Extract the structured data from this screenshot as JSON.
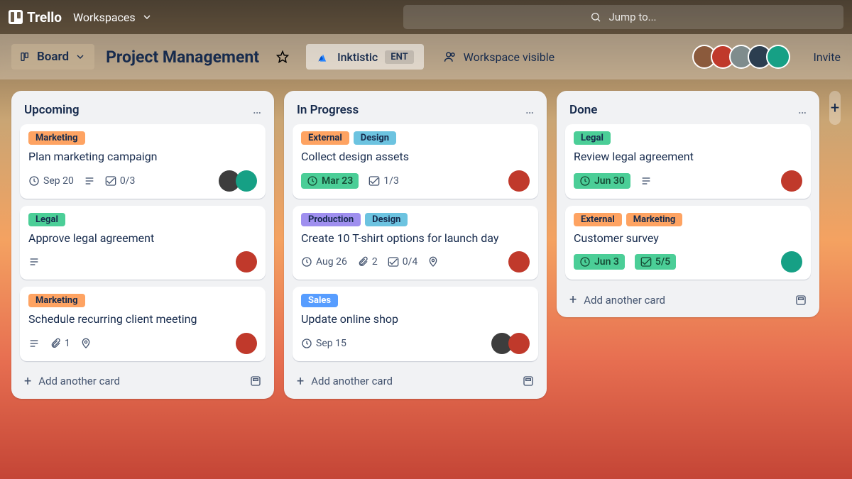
{
  "topbar": {
    "brand": "Trello",
    "workspaces_label": "Workspaces",
    "search_placeholder": "Jump to..."
  },
  "boardbar": {
    "view_label": "Board",
    "board_title": "Project Management",
    "workspace_name": "Inktistic",
    "workspace_badge": "ENT",
    "visibility_label": "Workspace visible",
    "invite_label": "Invite",
    "member_colors": [
      "#8b5a3c",
      "#c0392b",
      "#7f8c8d",
      "#2c3e50",
      "#16a085"
    ]
  },
  "lists": [
    {
      "title": "Upcoming",
      "add_label": "Add another card",
      "cards": [
        {
          "labels": [
            {
              "text": "Marketing",
              "color": "orange"
            }
          ],
          "title": "Plan marketing campaign",
          "due": "Sep 20",
          "due_style": "plain",
          "desc": true,
          "checklist": "0/3",
          "members": [
            "#3d3d3d",
            "#16a085"
          ]
        },
        {
          "labels": [
            {
              "text": "Legal",
              "color": "green"
            }
          ],
          "title": "Approve legal agreement",
          "desc": true,
          "members": [
            "#c0392b"
          ]
        },
        {
          "labels": [
            {
              "text": "Marketing",
              "color": "orange"
            }
          ],
          "title": "Schedule recurring client meeting",
          "desc": true,
          "attach": "1",
          "location": true,
          "members": [
            "#c0392b"
          ]
        }
      ]
    },
    {
      "title": "In Progress",
      "add_label": "Add another card",
      "cards": [
        {
          "labels": [
            {
              "text": "External",
              "color": "orange"
            },
            {
              "text": "Design",
              "color": "cyan"
            }
          ],
          "title": "Collect design assets",
          "due": "Mar 23",
          "due_style": "green",
          "checklist": "1/3",
          "members": [
            "#c0392b"
          ]
        },
        {
          "labels": [
            {
              "text": "Production",
              "color": "purple"
            },
            {
              "text": "Design",
              "color": "cyan"
            }
          ],
          "title": "Create 10 T-shirt options for launch day",
          "due": "Aug 26",
          "due_style": "plain",
          "attach": "2",
          "checklist": "0/4",
          "location": true,
          "members": [
            "#c0392b"
          ]
        },
        {
          "labels": [
            {
              "text": "Sales",
              "color": "blue"
            }
          ],
          "title": "Update online shop",
          "due": "Sep 15",
          "due_style": "plain",
          "members": [
            "#3d3d3d",
            "#c0392b"
          ]
        }
      ]
    },
    {
      "title": "Done",
      "add_label": "Add another card",
      "cards": [
        {
          "labels": [
            {
              "text": "Legal",
              "color": "green"
            }
          ],
          "title": "Review legal agreement",
          "due": "Jun 30",
          "due_style": "green",
          "desc": true,
          "members": [
            "#c0392b"
          ]
        },
        {
          "labels": [
            {
              "text": "External",
              "color": "orange"
            },
            {
              "text": "Marketing",
              "color": "orange"
            }
          ],
          "title": "Customer survey",
          "due": "Jun 3",
          "due_style": "green",
          "checklist": "5/5",
          "checklist_style": "green",
          "members": [
            "#16a085"
          ]
        }
      ]
    }
  ]
}
